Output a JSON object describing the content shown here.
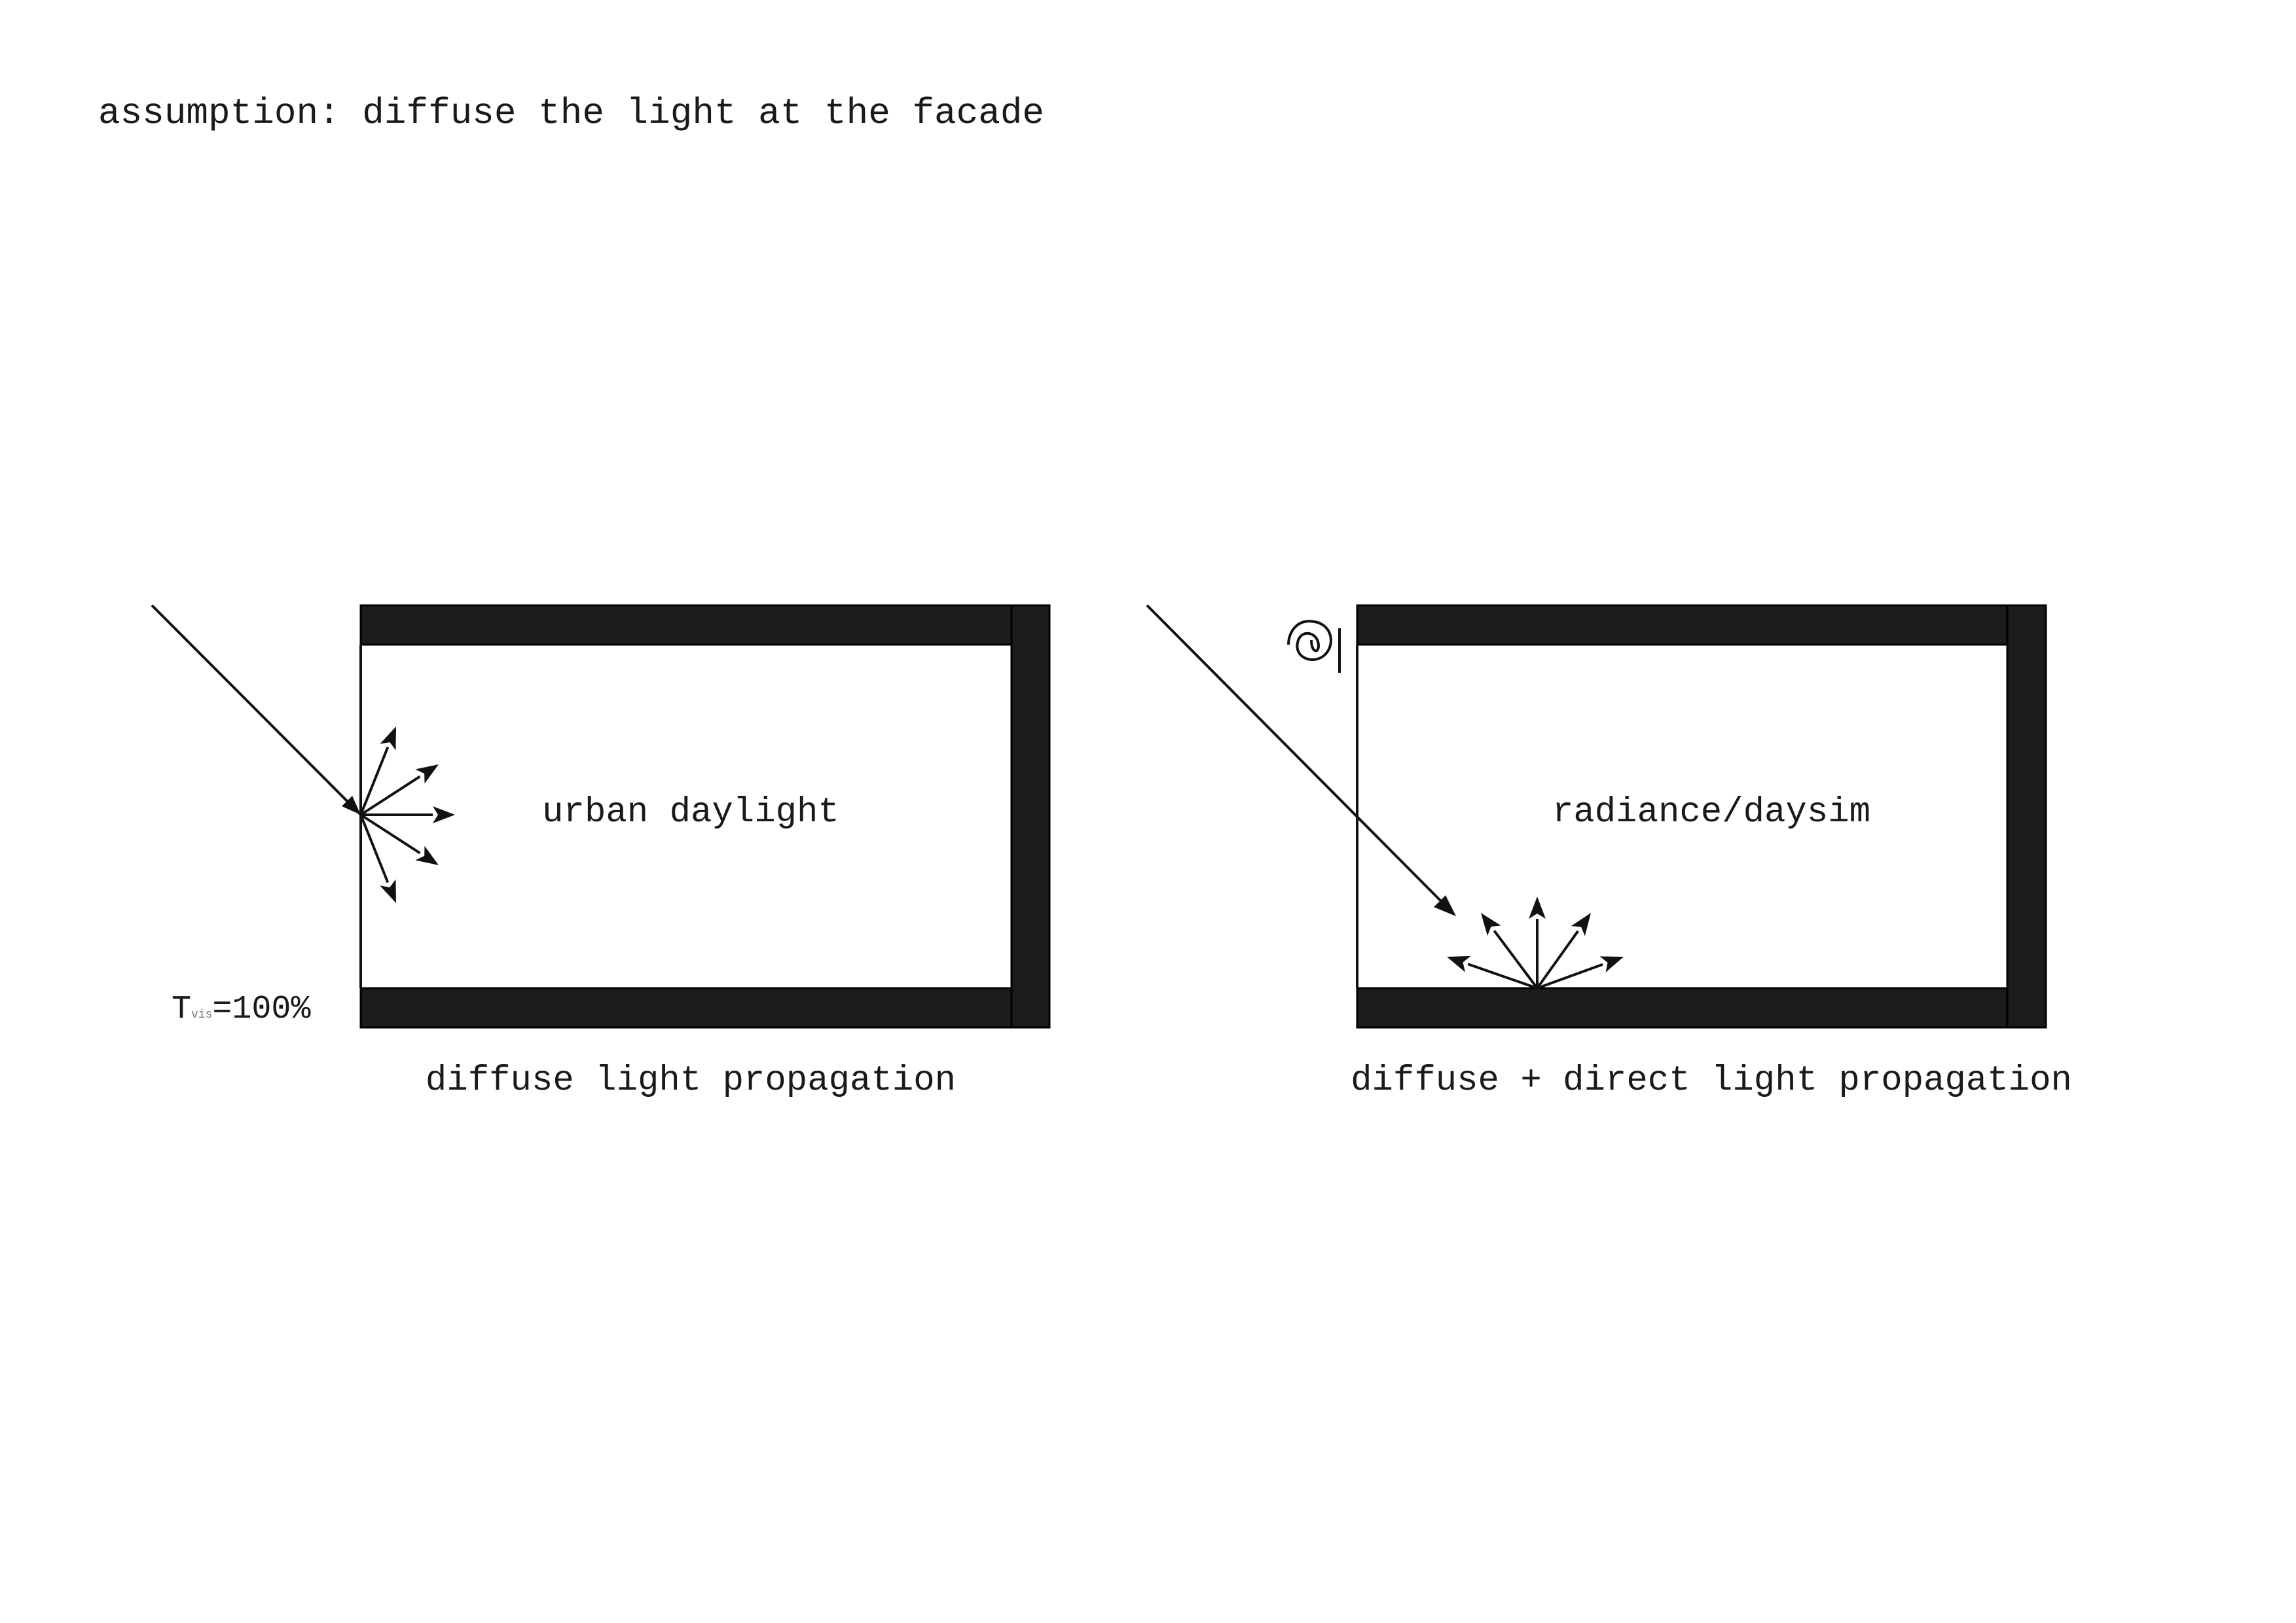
{
  "title": "assumption: diffuse the light at the facade",
  "left_panel": {
    "room_label": "urban daylight",
    "caption": "diffuse light propagation",
    "transmittance_symbol": "T",
    "transmittance_subscript": "vis",
    "transmittance_value": "=100%",
    "scatter_point": "facade"
  },
  "right_panel": {
    "room_label": "radiance/daysim",
    "caption": "diffuse + direct light propagation",
    "scatter_point": "floor"
  },
  "colors": {
    "wall": "#1c1c1c",
    "line": "#111111",
    "background": "#ffffff"
  },
  "icons": {
    "spiral": "spiral-icon"
  }
}
